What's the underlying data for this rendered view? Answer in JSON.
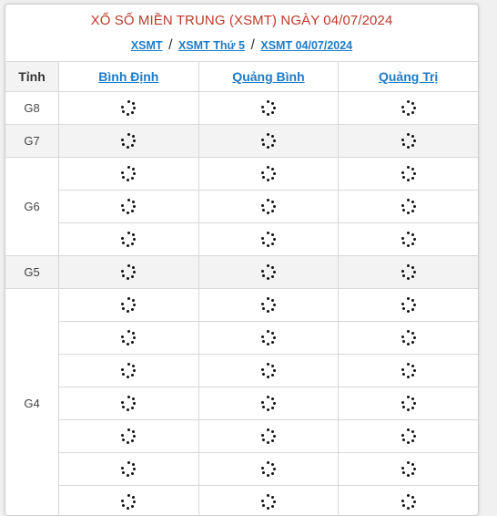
{
  "header": {
    "title": "XỔ SỐ MIỀN TRUNG (XSMT) NGÀY 04/07/2024",
    "breadcrumbs": [
      "XSMT",
      "XSMT Thứ 5",
      "XSMT 04/07/2024"
    ],
    "separator": "/"
  },
  "table": {
    "label_header": "Tỉnh",
    "provinces": [
      "Bình Định",
      "Quảng Bình",
      "Quảng Trị"
    ],
    "prizes": [
      {
        "label": "G8",
        "rows": 1,
        "shaded": false
      },
      {
        "label": "G7",
        "rows": 1,
        "shaded": true
      },
      {
        "label": "G6",
        "rows": 3,
        "shaded": false
      },
      {
        "label": "G5",
        "rows": 1,
        "shaded": true
      },
      {
        "label": "G4",
        "rows": 7,
        "shaded": false
      }
    ],
    "cell_state": "loading-spinner-icon"
  }
}
